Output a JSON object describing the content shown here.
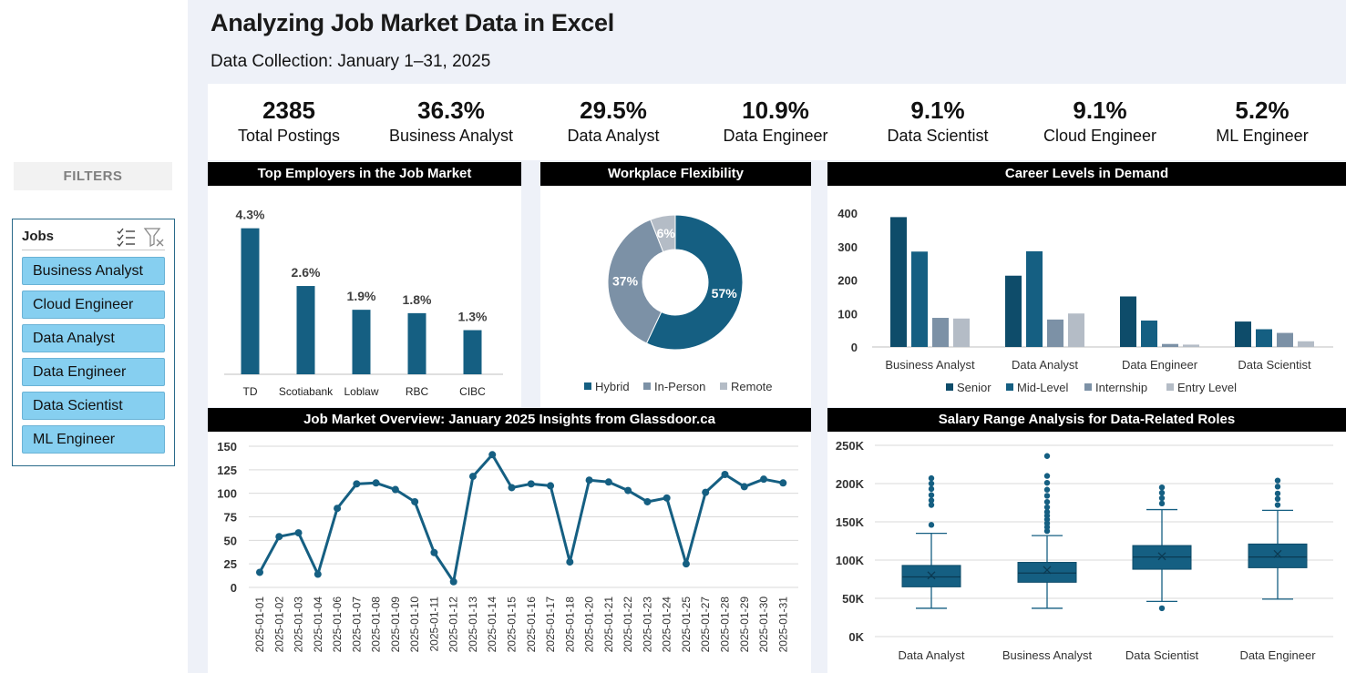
{
  "header": {
    "title": "Analyzing Job Market Data in Excel",
    "subtitle": "Data Collection: January 1–31, 2025"
  },
  "sidebar": {
    "filters_label": "FILTERS",
    "slicer": {
      "title": "Jobs",
      "multiselect_icon": "multi-select-icon",
      "clear_icon": "clear-filter-icon",
      "items": [
        "Business Analyst",
        "Cloud Engineer",
        "Data Analyst",
        "Data Engineer",
        "Data Scientist",
        "ML Engineer"
      ]
    }
  },
  "kpis": [
    {
      "value": "2385",
      "label": "Total Postings"
    },
    {
      "value": "36.3%",
      "label": "Business Analyst"
    },
    {
      "value": "29.5%",
      "label": "Data Analyst"
    },
    {
      "value": "10.9%",
      "label": "Data Engineer"
    },
    {
      "value": "9.1%",
      "label": "Data Scientist"
    },
    {
      "value": "9.1%",
      "label": "Cloud Engineer"
    },
    {
      "value": "5.2%",
      "label": "ML Engineer"
    }
  ],
  "colors": {
    "primary": "#155f82",
    "dark": "#0e4c6a",
    "mid": "#7c91a6",
    "light": "#b4bcc6",
    "filter_blue": "#86cff0"
  },
  "chart_data": [
    {
      "id": "employers",
      "type": "bar",
      "title": "Top Employers in the Job Market",
      "categories": [
        "TD",
        "Scotiabank",
        "Loblaw",
        "RBC",
        "CIBC"
      ],
      "values": [
        4.3,
        2.6,
        1.9,
        1.8,
        1.3
      ],
      "data_labels": [
        "4.3%",
        "2.6%",
        "1.9%",
        "1.8%",
        "1.3%"
      ],
      "ylim": [
        0,
        4.8
      ],
      "grid": false
    },
    {
      "id": "flexibility",
      "type": "pie",
      "subtype": "donut",
      "title": "Workplace Flexibility",
      "categories": [
        "Hybrid",
        "In-Person",
        "Remote"
      ],
      "values": [
        57,
        37,
        6
      ],
      "data_labels": [
        "57%",
        "37%",
        "6%"
      ],
      "colors": [
        "#155f82",
        "#7c91a6",
        "#b4bcc6"
      ],
      "legend": "bottom"
    },
    {
      "id": "career_levels",
      "type": "bar",
      "title": "Career Levels in Demand",
      "categories": [
        "Business Analyst",
        "Data Analyst",
        "Data Engineer",
        "Data Scientist"
      ],
      "series": [
        {
          "name": "Senior",
          "values": [
            388,
            213,
            151,
            76
          ],
          "color": "#0e4c6a"
        },
        {
          "name": "Mid-Level",
          "values": [
            285,
            286,
            79,
            53
          ],
          "color": "#155f82"
        },
        {
          "name": "Internship",
          "values": [
            87,
            82,
            9,
            42
          ],
          "color": "#7c91a6"
        },
        {
          "name": "Entry Level",
          "values": [
            85,
            100,
            7,
            17
          ],
          "color": "#b4bcc6"
        }
      ],
      "yticks": [
        "0",
        "100",
        "200",
        "300",
        "400"
      ],
      "ylim": [
        0,
        400
      ],
      "legend": "bottom",
      "grid": false
    },
    {
      "id": "overview",
      "type": "line",
      "title": "Job Market Overview: January 2025 Insights from Glassdoor.ca",
      "x": [
        "2025-01-01",
        "2025-01-02",
        "2025-01-03",
        "2025-01-04",
        "2025-01-06",
        "2025-01-07",
        "2025-01-08",
        "2025-01-09",
        "2025-01-10",
        "2025-01-11",
        "2025-01-12",
        "2025-01-13",
        "2025-01-14",
        "2025-01-15",
        "2025-01-16",
        "2025-01-17",
        "2025-01-18",
        "2025-01-20",
        "2025-01-21",
        "2025-01-22",
        "2025-01-23",
        "2025-01-24",
        "2025-01-25",
        "2025-01-27",
        "2025-01-28",
        "2025-01-29",
        "2025-01-30",
        "2025-01-31"
      ],
      "values": [
        16,
        54,
        58,
        14,
        84,
        110,
        111,
        104,
        91,
        37,
        6,
        118,
        141,
        106,
        110,
        108,
        27,
        114,
        112,
        103,
        91,
        95,
        25,
        101,
        120,
        107,
        115,
        111
      ],
      "yticks": [
        "0",
        "25",
        "50",
        "75",
        "100",
        "125",
        "150"
      ],
      "ylim": [
        0,
        150
      ],
      "grid": true
    },
    {
      "id": "salary",
      "type": "box",
      "title": "Salary Range Analysis for Data-Related Roles",
      "categories": [
        "Data Analyst",
        "Business Analyst",
        "Data Scientist",
        "Data Engineer"
      ],
      "boxes": [
        {
          "min": 37000,
          "q1": 65000,
          "median": 78000,
          "q3": 93000,
          "max": 135000,
          "mean": 80000,
          "outliers": [
            146000,
            172000,
            178000,
            185000,
            193000,
            200000,
            207000
          ]
        },
        {
          "min": 37000,
          "q1": 71000,
          "median": 83000,
          "q3": 97000,
          "max": 132000,
          "mean": 87000,
          "outliers": [
            138000,
            143000,
            148000,
            153000,
            158000,
            163000,
            169000,
            176000,
            184000,
            192000,
            201000,
            210000,
            236000
          ]
        },
        {
          "min": 46000,
          "q1": 88000,
          "median": 104000,
          "q3": 119000,
          "max": 166000,
          "mean": 105000,
          "outliers": [
            37000,
            174000,
            181000,
            188000,
            195000
          ]
        },
        {
          "min": 49000,
          "q1": 90000,
          "median": 104000,
          "q3": 121000,
          "max": 165000,
          "mean": 108000,
          "outliers": [
            172000,
            180000,
            187000,
            196000,
            204000
          ]
        }
      ],
      "yticks": [
        "0K",
        "50K",
        "100K",
        "150K",
        "200K",
        "250K"
      ],
      "ylim": [
        0,
        250000
      ],
      "grid": true
    }
  ]
}
